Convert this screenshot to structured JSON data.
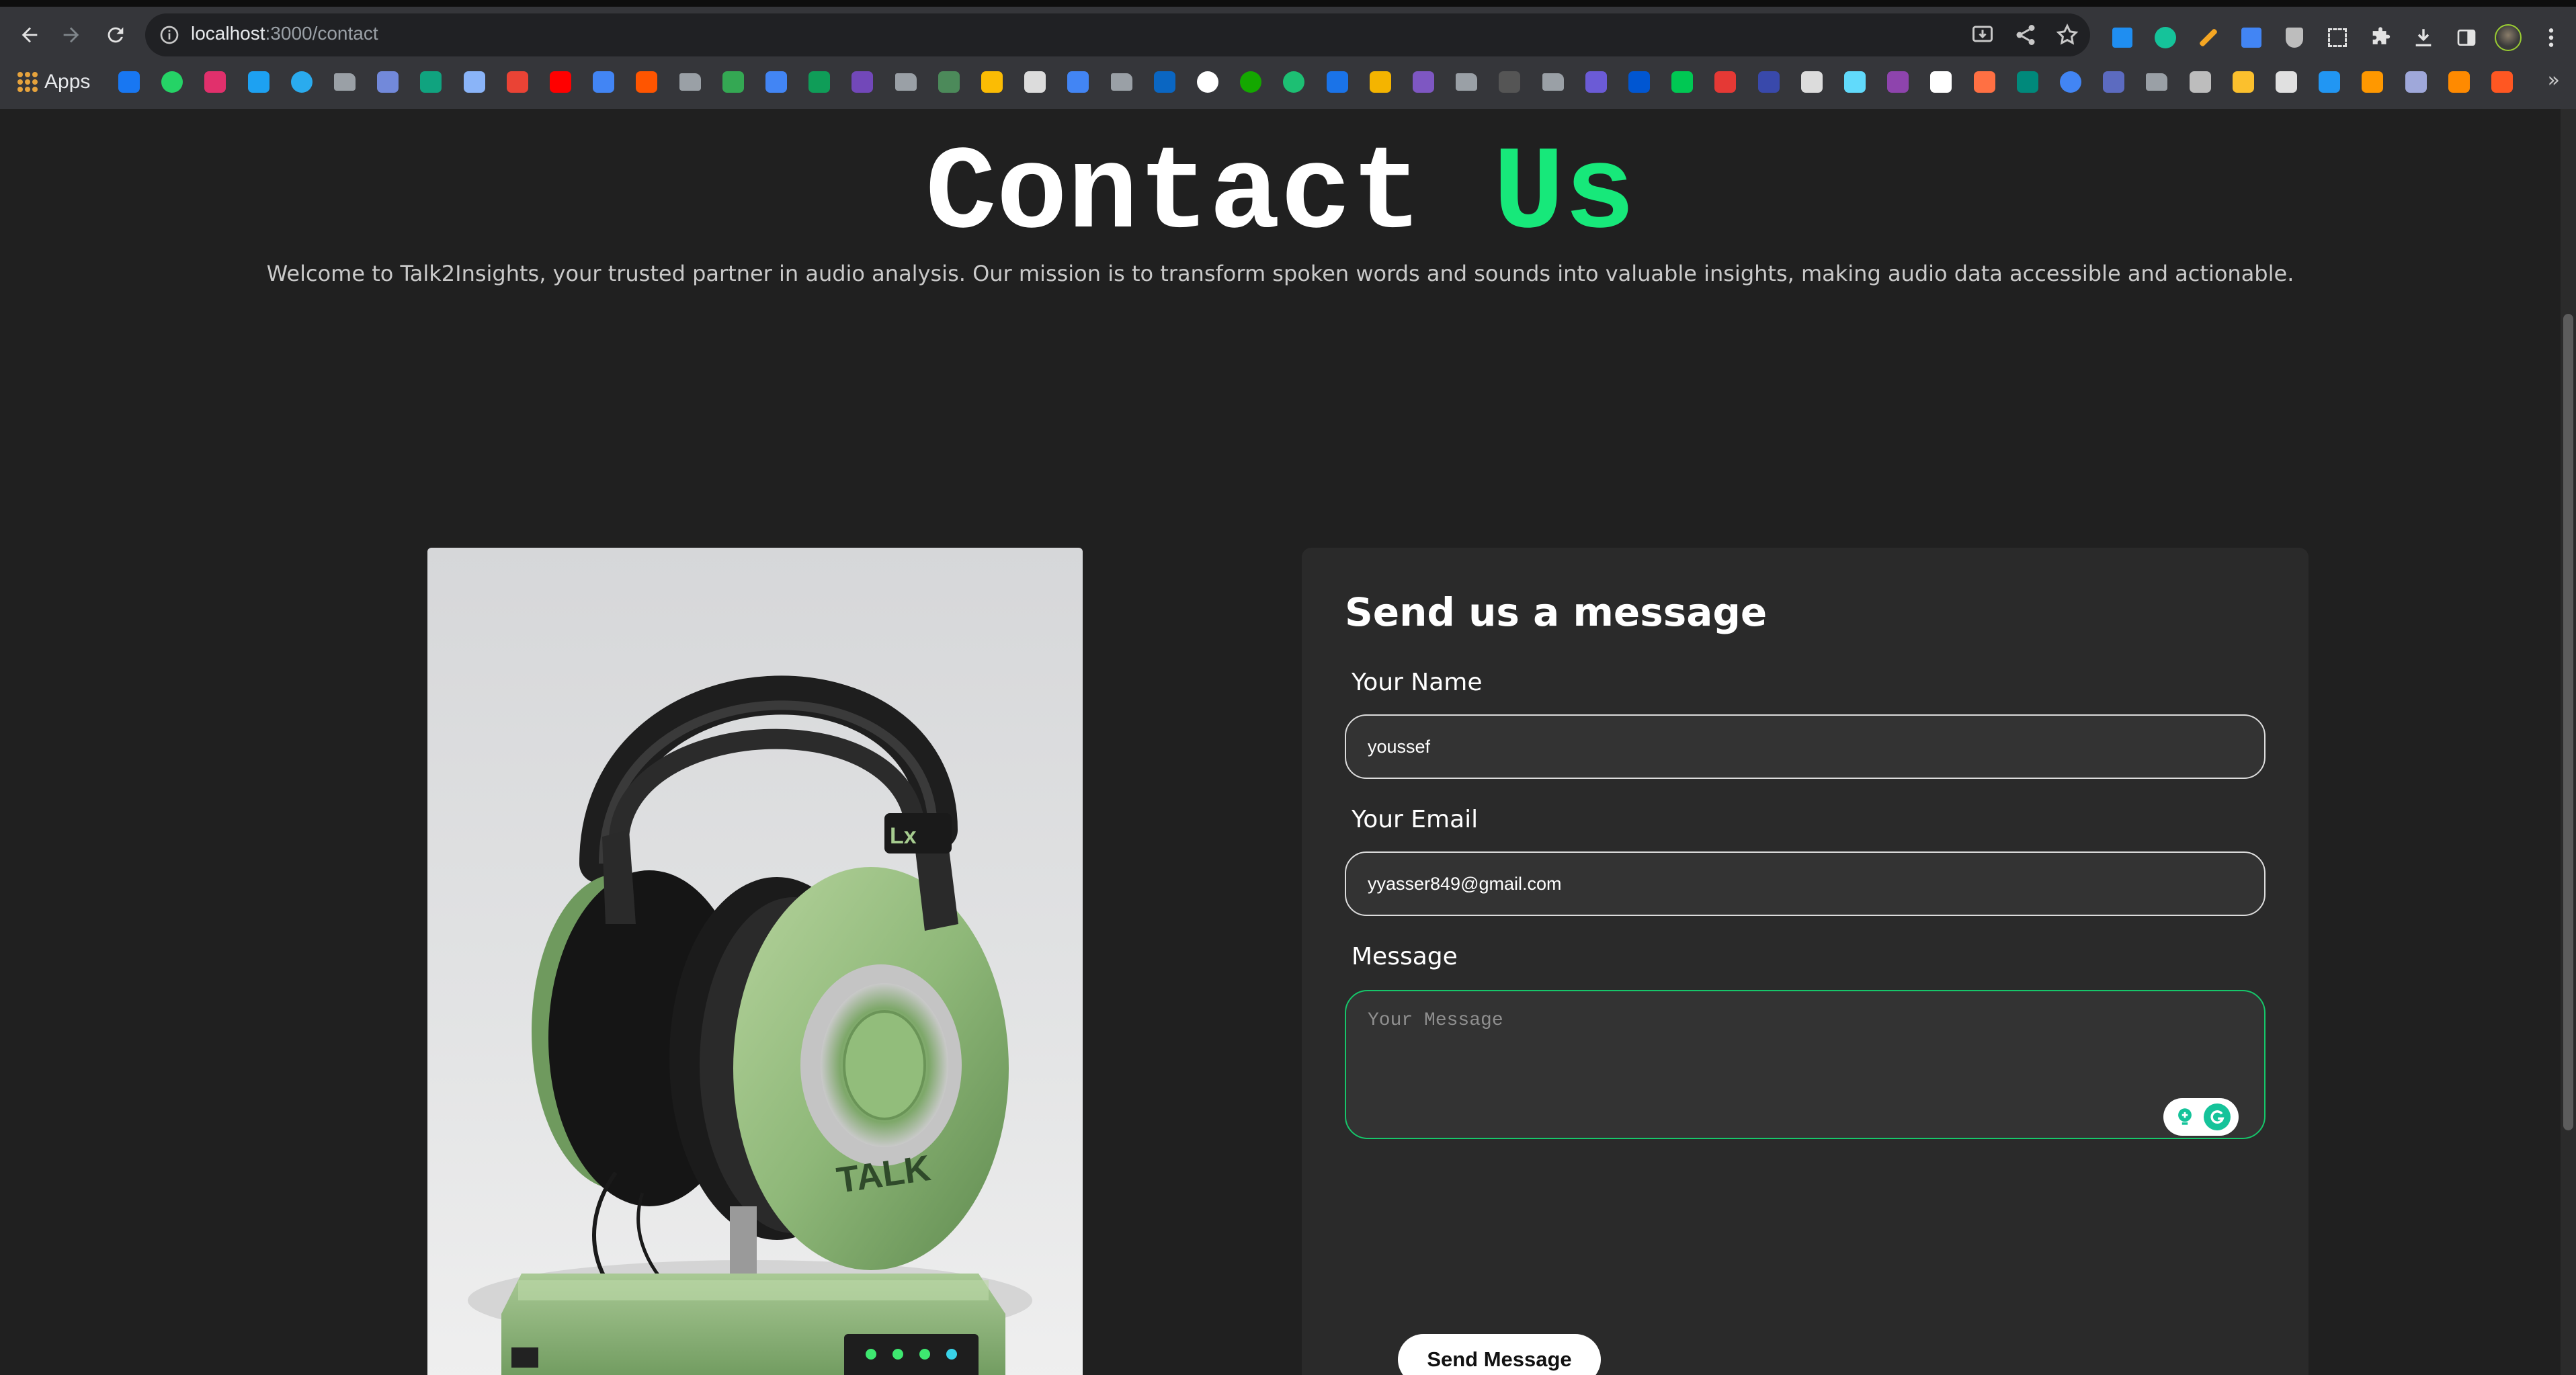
{
  "browser": {
    "url_host": "localhost",
    "url_path": ":3000/contact",
    "bookmarks_apps_label": "Apps",
    "more_bookmarks": "»",
    "bookmark_icons": [
      "facebook-icon",
      "whatsapp-icon",
      "instagram-icon",
      "twitter-icon",
      "telegram-icon",
      "folder-icon",
      "discord-icon",
      "chatgpt-icon",
      "gemini-icon",
      "gmail-icon",
      "youtube-icon",
      "translate-icon",
      "soundcloud-icon",
      "folder-icon",
      "drive-icon",
      "docs-icon",
      "sheets-icon",
      "forms-icon",
      "folder-icon",
      "bookmark-icon",
      "drive-icon",
      "bookmark-icon",
      "charts-icon",
      "folder-icon",
      "linkedin-icon",
      "github-icon",
      "upwork-icon",
      "fiverr-icon",
      "bookmark-icon",
      "bookmark-icon",
      "bookmark-icon",
      "folder-icon",
      "bookmark-icon",
      "folder-icon",
      "bookmark-icon",
      "coursera-icon",
      "bookmark-icon",
      "bookmark-icon",
      "bookmark-icon",
      "square-icon",
      "react-icon",
      "bookmark-icon",
      "x-icon",
      "bookmark-icon",
      "bookmark-icon",
      "google-icon",
      "bookmark-icon",
      "folder-icon",
      "bookmark-icon",
      "bookmark-icon",
      "infinity-icon",
      "bookmark-icon",
      "bookmark-icon",
      "bookmark-icon",
      "bookmark-icon",
      "bookmark-icon"
    ]
  },
  "page": {
    "heading_main": "Contact ",
    "heading_accent": "Us",
    "intro": "Welcome to Talk2Insights, your trusted partner in audio analysis. Our mission is to transform spoken words and sounds into valuable insights, making audio data accessible and actionable.",
    "image_alt": "Green headphones on a device",
    "image_brand_text": "TALK",
    "image_logo_text": "Lx"
  },
  "form": {
    "title": "Send us a message",
    "name_label": "Your Name",
    "name_value": "youssef",
    "email_label": "Your Email",
    "email_value": "yyasser849@gmail.com",
    "message_label": "Message",
    "message_placeholder": "Your Message",
    "submit_label": "Send Message"
  },
  "colors": {
    "accent": "#17e87a",
    "page_bg": "#202020",
    "card_bg": "#2a2a2a"
  }
}
